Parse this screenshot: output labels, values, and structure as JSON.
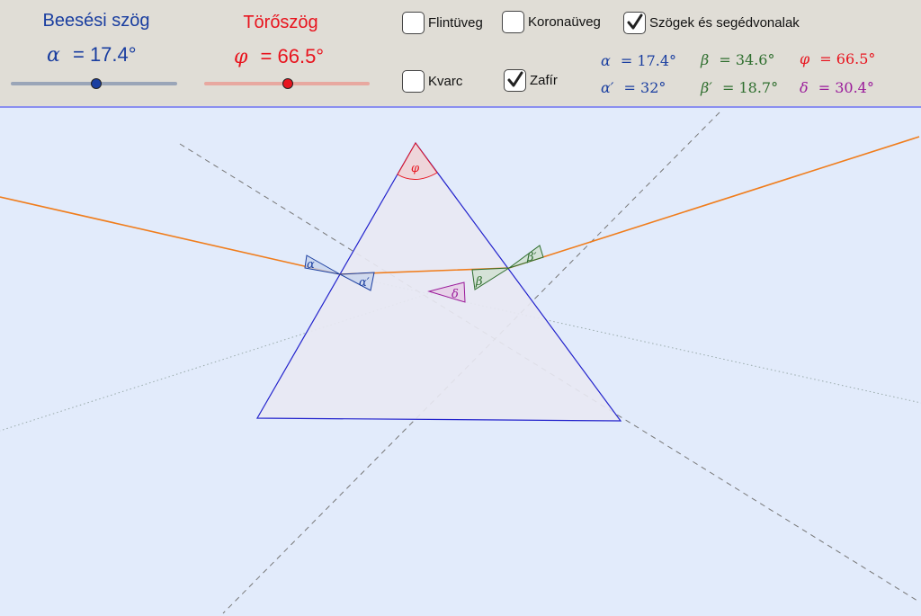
{
  "colors": {
    "alpha": "#1a3ea0",
    "phi": "#e8141e",
    "beta": "#2e6e2e",
    "delta": "#9a1a9a",
    "ray": "#f07d1c",
    "prism_edge": "#2222cc",
    "prism_fill": "#e9e9f3",
    "background": "#e2ebfb",
    "toolbar": "#e0ddd6"
  },
  "slider_alpha": {
    "title": "Beesési szög",
    "symbol": "α",
    "value_text": "= 17.4°",
    "value": 17.4
  },
  "slider_phi": {
    "title": "Törőszög",
    "symbol": "φ",
    "value_text": "= 66.5°",
    "value": 66.5
  },
  "checkboxes": {
    "flint": {
      "label": "Flintüveg",
      "checked": false
    },
    "korona": {
      "label": "Koronaüveg",
      "checked": false
    },
    "segedvonalak": {
      "label": "Szögek és segédvonalak",
      "checked": true
    },
    "kvarc": {
      "label": "Kvarc",
      "checked": false
    },
    "zafir": {
      "label": "Zafír",
      "checked": true
    }
  },
  "stats": {
    "alpha": {
      "sym": "α",
      "val": "= 17.4°"
    },
    "beta": {
      "sym": "β",
      "val": "= 34.6°"
    },
    "phi": {
      "sym": "φ",
      "val": "= 66.5°"
    },
    "alpha_prime": {
      "sym": "α′",
      "val": "= 32°"
    },
    "beta_prime": {
      "sym": "β′",
      "val": "= 18.7°"
    },
    "delta": {
      "sym": "δ",
      "val": "= 30.4°"
    }
  },
  "canvas_labels": {
    "phi": "φ",
    "alpha": "α",
    "alpha_prime": "α′",
    "beta": "β",
    "beta_prime": "β′",
    "delta": "δ"
  }
}
